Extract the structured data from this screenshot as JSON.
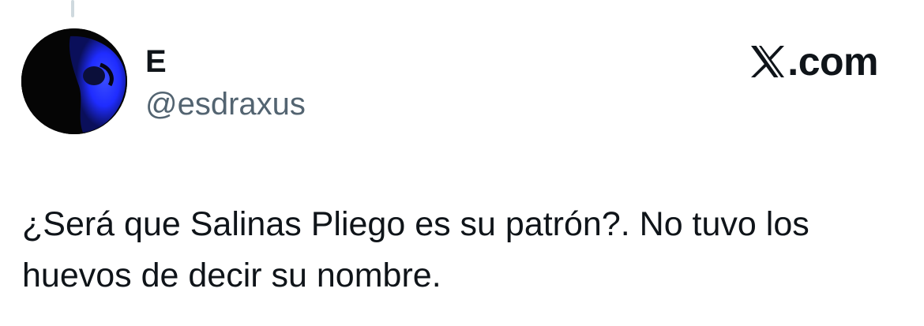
{
  "tweet": {
    "author": {
      "display_name": "E",
      "handle": "@esdraxus",
      "avatar_icon": "avatar-image"
    },
    "brand": {
      "icon": "x-logo-icon",
      "suffix": ".com"
    },
    "text": "¿Será que Salinas Pliego es su patrón?. No tuvo los huevos de decir su nombre."
  },
  "colors": {
    "text_primary": "#0f1419",
    "text_secondary": "#536471",
    "thread_line": "#cfd9de",
    "avatar_accent": "#1f2cff"
  }
}
